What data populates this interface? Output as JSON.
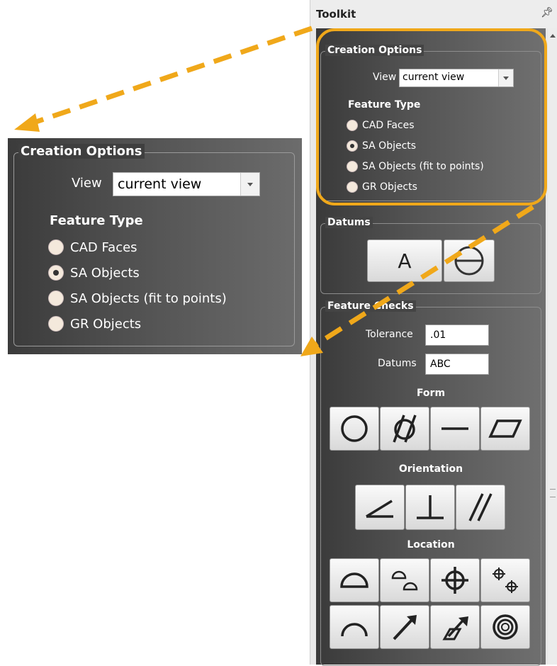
{
  "toolkit": {
    "title": "Toolkit",
    "pin_icon": "pin-icon"
  },
  "creation": {
    "legend": "Creation Options",
    "view_label": "View",
    "view_value": "current view",
    "feature_type_label": "Feature Type",
    "options": [
      {
        "label": "CAD Faces",
        "selected": false
      },
      {
        "label": "SA Objects",
        "selected": true
      },
      {
        "label": "SA Objects (fit to points)",
        "selected": false
      },
      {
        "label": "GR Objects",
        "selected": false
      }
    ]
  },
  "datums": {
    "legend": "Datums",
    "button_a": "A",
    "icons": [
      "datum-a-icon",
      "datum-target-icon"
    ]
  },
  "feature_checks": {
    "legend": "Feature Checks",
    "tolerance_label": "Tolerance",
    "tolerance_value": ".01",
    "datums_label": "Datums",
    "datums_value": "ABC",
    "form_label": "Form",
    "form_icons": [
      "circularity-icon",
      "cylindricity-icon",
      "straightness-icon",
      "flatness-icon"
    ],
    "orientation_label": "Orientation",
    "orientation_icons": [
      "angularity-icon",
      "perpendicularity-icon",
      "parallelism-icon"
    ],
    "location_label": "Location",
    "location_icons_row1": [
      "profile-surface-icon",
      "profile-line-icon",
      "position-icon",
      "position-pattern-icon"
    ],
    "location_icons_row2": [
      "profile-arc-icon",
      "circular-runout-icon",
      "total-runout-icon",
      "concentricity-icon"
    ]
  },
  "colors": {
    "highlight": "#f0a81a",
    "panel_dark": "#3a3a3a"
  }
}
